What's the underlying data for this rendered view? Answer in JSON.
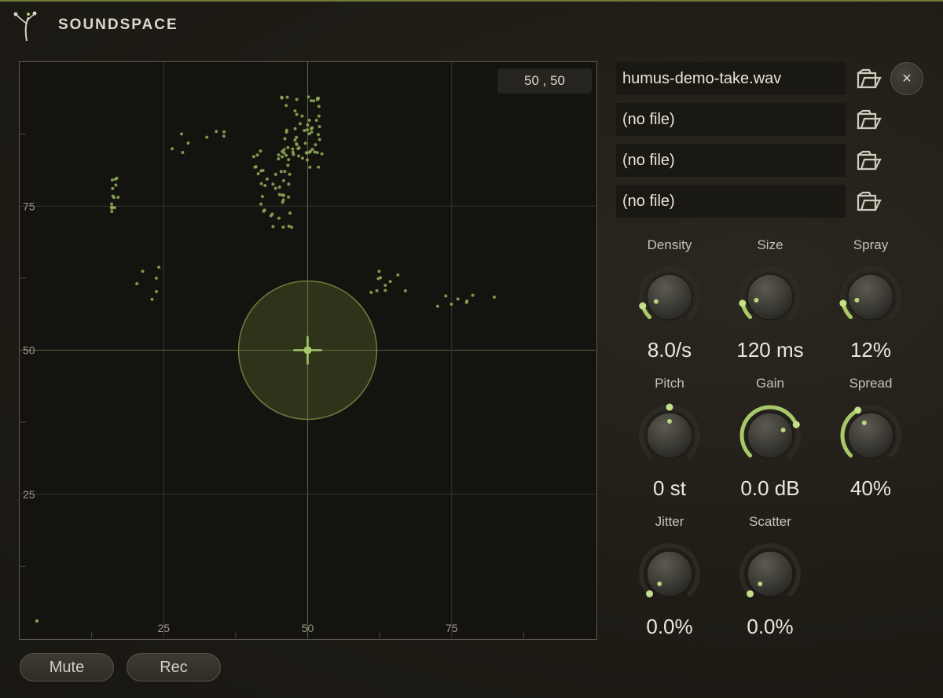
{
  "app": {
    "title": "SOUNDSPACE",
    "accent_color": "#a7c96a",
    "icons": [
      "sprout-logo-icon",
      "folder-open-icon",
      "close-icon",
      "crosshair-icon"
    ]
  },
  "pad": {
    "position_readout": "50 , 50",
    "x_ticks": [
      "25",
      "50",
      "75"
    ],
    "y_ticks": [
      "75",
      "50",
      "25"
    ],
    "cursor": {
      "x": 50,
      "y": 50,
      "radius": 12
    }
  },
  "files": [
    {
      "name": "humus-demo-take.wav"
    },
    {
      "name": "(no file)"
    },
    {
      "name": "(no file)"
    },
    {
      "name": "(no file)"
    }
  ],
  "close_label": "×",
  "knobs": [
    {
      "label": "Density",
      "value": "8.0/s",
      "level": 0.1
    },
    {
      "label": "Size",
      "value": "120 ms",
      "level": 0.12
    },
    {
      "label": "Spray",
      "value": "12%",
      "level": 0.12
    },
    {
      "label": "Pitch",
      "value": "0 st",
      "level": 0.5
    },
    {
      "label": "Gain",
      "value": "0.0 dB",
      "level": 0.75
    },
    {
      "label": "Spread",
      "value": "40%",
      "level": 0.4
    },
    {
      "label": "Jitter",
      "value": "0.0%",
      "level": 0.0
    },
    {
      "label": "Scatter",
      "value": "0.0%",
      "level": 0.0
    }
  ],
  "buttons": {
    "mute": "Mute",
    "rec": "Rec"
  }
}
